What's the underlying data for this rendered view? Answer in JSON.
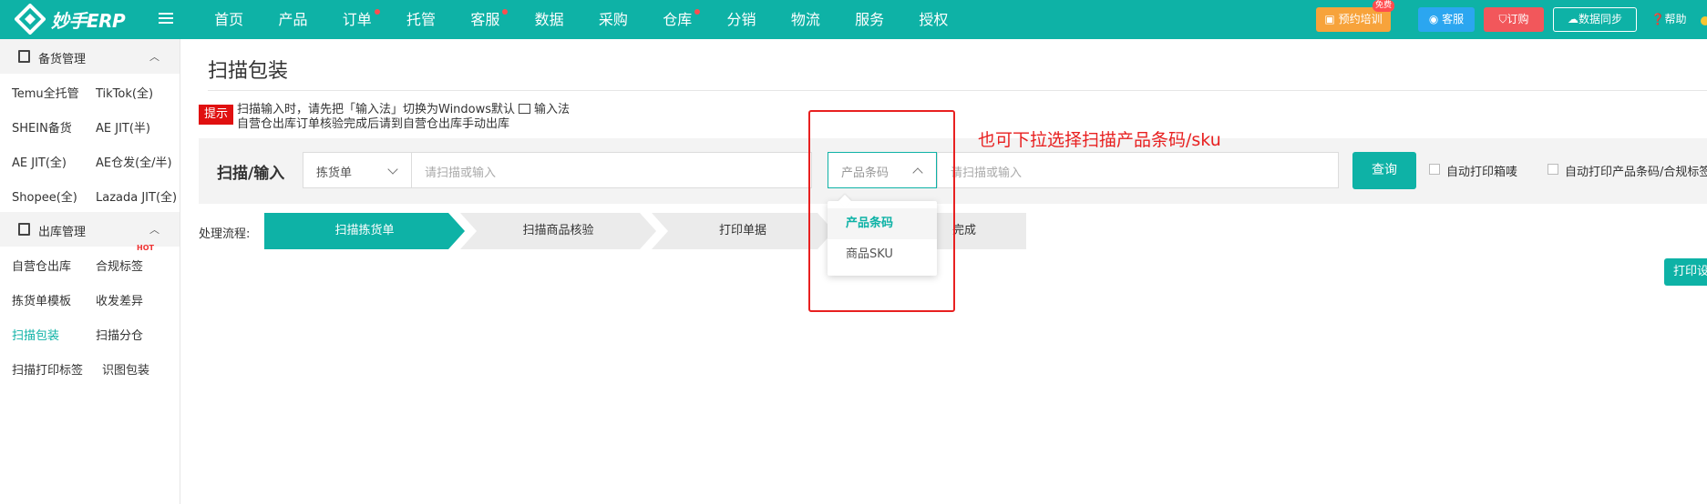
{
  "app": {
    "logo_text": "妙手ERP"
  },
  "nav": {
    "items": [
      {
        "label": "首页",
        "dot": false
      },
      {
        "label": "产品",
        "dot": false
      },
      {
        "label": "订单",
        "dot": true
      },
      {
        "label": "托管",
        "dot": false
      },
      {
        "label": "客服",
        "dot": true
      },
      {
        "label": "数据",
        "dot": false
      },
      {
        "label": "采购",
        "dot": false
      },
      {
        "label": "仓库",
        "dot": true
      },
      {
        "label": "分销",
        "dot": false
      },
      {
        "label": "物流",
        "dot": false
      },
      {
        "label": "服务",
        "dot": false
      },
      {
        "label": "授权",
        "dot": false
      }
    ]
  },
  "toolbar": {
    "training": "预约培训",
    "training_badge": "免费",
    "service": "客服",
    "order": "订购",
    "sync": "数据同步",
    "help": "帮助"
  },
  "sidebar": {
    "group1": "备货管理",
    "rows1": [
      [
        "Temu全托管",
        "TikTok(全)"
      ],
      [
        "SHEIN备货",
        "AE JIT(半)"
      ],
      [
        "AE JIT(全)",
        "AE仓发(全/半)"
      ],
      [
        "Shopee(全)",
        "Lazada JIT(全)"
      ]
    ],
    "group2": "出库管理",
    "rows2": [
      [
        "自营仓出库",
        "合规标签"
      ],
      [
        "拣货单模板",
        "收发差异"
      ],
      [
        "扫描包装",
        "扫描分仓"
      ],
      [
        "扫描打印标签",
        "识图包装"
      ]
    ],
    "hot_badge": "HOT"
  },
  "main": {
    "title": "扫描包装",
    "tip_tag": "提示",
    "tip_line1_a": "扫描输入时，请先把「输入法」切换为Windows默认",
    "tip_line1_b": "输入法",
    "tip_line2": "自营仓出库订单核验完成后请到自营仓出库手动出库",
    "scan_label": "扫描/输入",
    "select1_value": "拣货单",
    "input1_placeholder": "请扫描或输入",
    "select2_value": "产品条码",
    "input2_placeholder": "请扫描或输入",
    "query_button": "查询",
    "auto_print_box": "自动打印箱唛",
    "auto_print_label": "自动打印产品条码/合规标签",
    "dropdown_options": [
      "产品条码",
      "商品SKU"
    ],
    "process_label": "处理流程:",
    "steps": [
      "扫描拣货单",
      "扫描商品核验",
      "打印单据",
      "完成"
    ],
    "print_settings": "打印设置"
  },
  "annotation": {
    "text": "也可下拉选择扫描产品条码/sku"
  },
  "colors": {
    "accent": "#0eb2a6",
    "annotation": "#e82020",
    "training": "#f7a33b",
    "service": "#2ba6f0",
    "order": "#f2575b"
  }
}
